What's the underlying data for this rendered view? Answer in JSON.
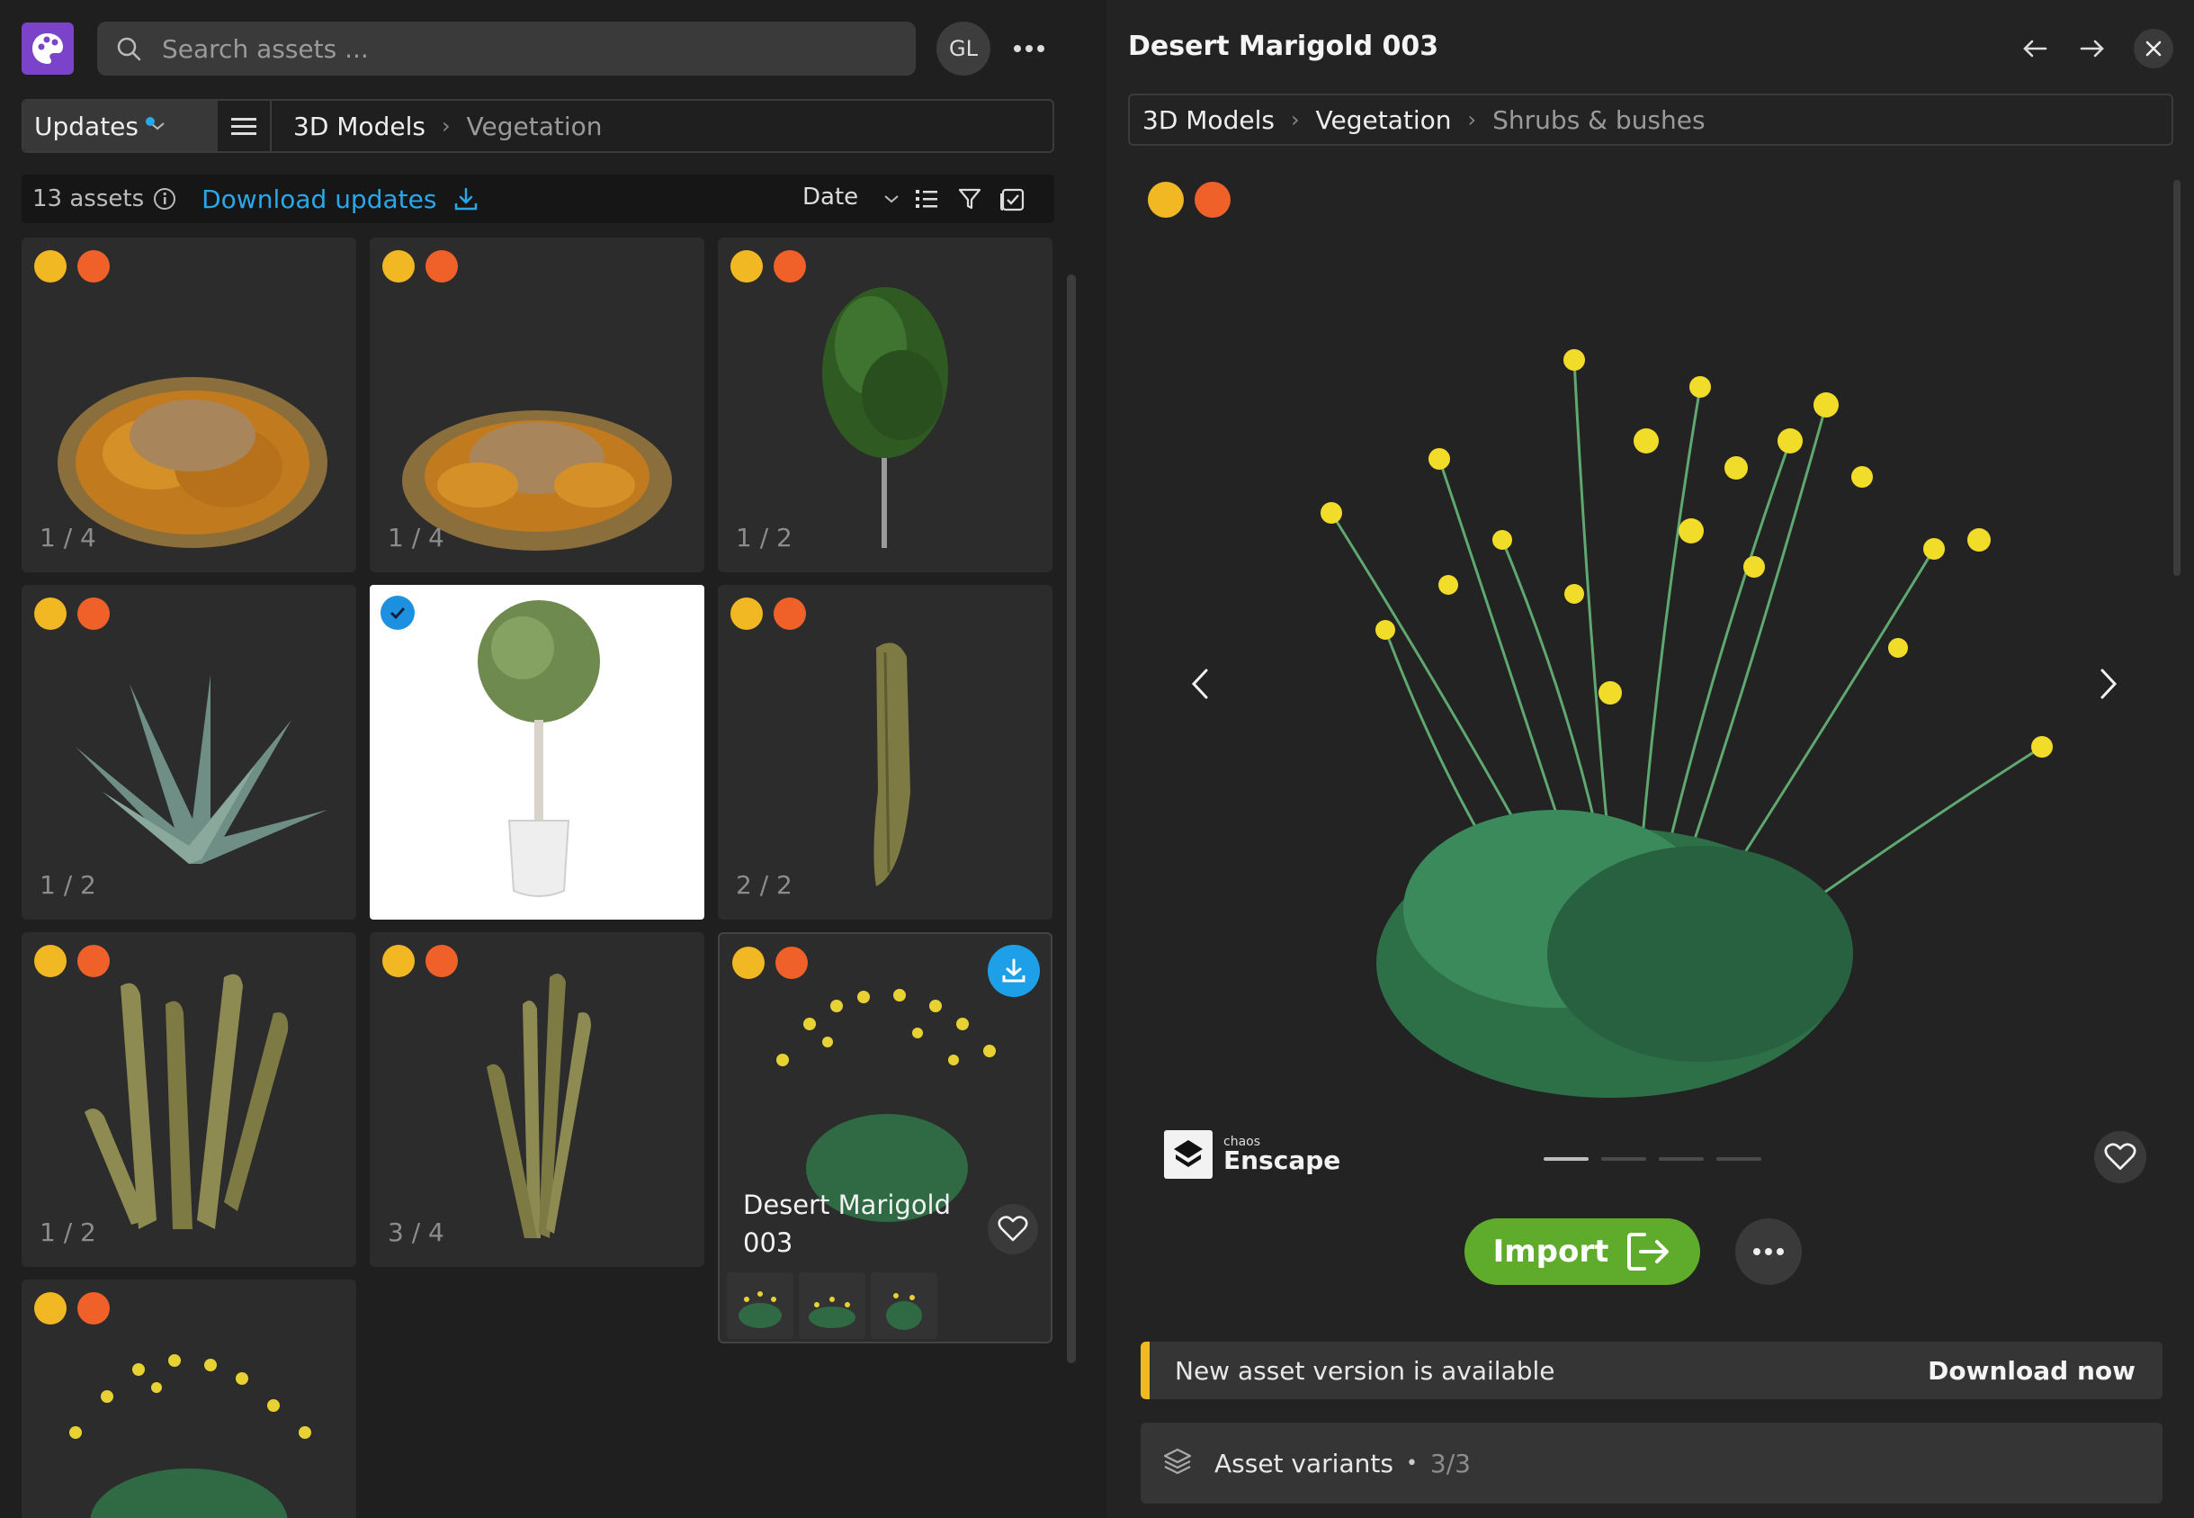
{
  "search": {
    "placeholder": "Search assets ..."
  },
  "user": {
    "initials": "GL"
  },
  "left_breadcrumb": {
    "filter_label": "Updates",
    "items": [
      "3D Models",
      "Vegetation"
    ]
  },
  "toolbar": {
    "count": "13 assets",
    "download_updates": "Download updates",
    "sort_label": "Date"
  },
  "grid": {
    "cards": [
      {
        "variant": "1 / 4"
      },
      {
        "variant": "1 / 4"
      },
      {
        "variant": "1 / 2"
      },
      {
        "variant": "1 / 2"
      },
      {
        "variant": ""
      },
      {
        "variant": "2 / 2"
      },
      {
        "variant": "1 / 2"
      },
      {
        "variant": "3 / 4"
      },
      {
        "title": "Desert Marigold 003"
      },
      {
        "variant": ""
      }
    ]
  },
  "detail": {
    "title": "Desert Marigold 003",
    "breadcrumb": [
      "3D Models",
      "Vegetation",
      "Shrubs & bushes"
    ],
    "brand_small": "chaos",
    "brand_name": "Enscape",
    "import_label": "Import",
    "notice": {
      "message": "New asset version is available",
      "action": "Download now"
    },
    "variants": {
      "label": "Asset variants",
      "count": "3/3"
    }
  },
  "colors": {
    "accent_blue": "#2aa7ea",
    "update_badge": "#f2b824",
    "ko_badge": "#f0612a",
    "import_green": "#5fac2c",
    "logo_purple": "#7a43c9"
  }
}
